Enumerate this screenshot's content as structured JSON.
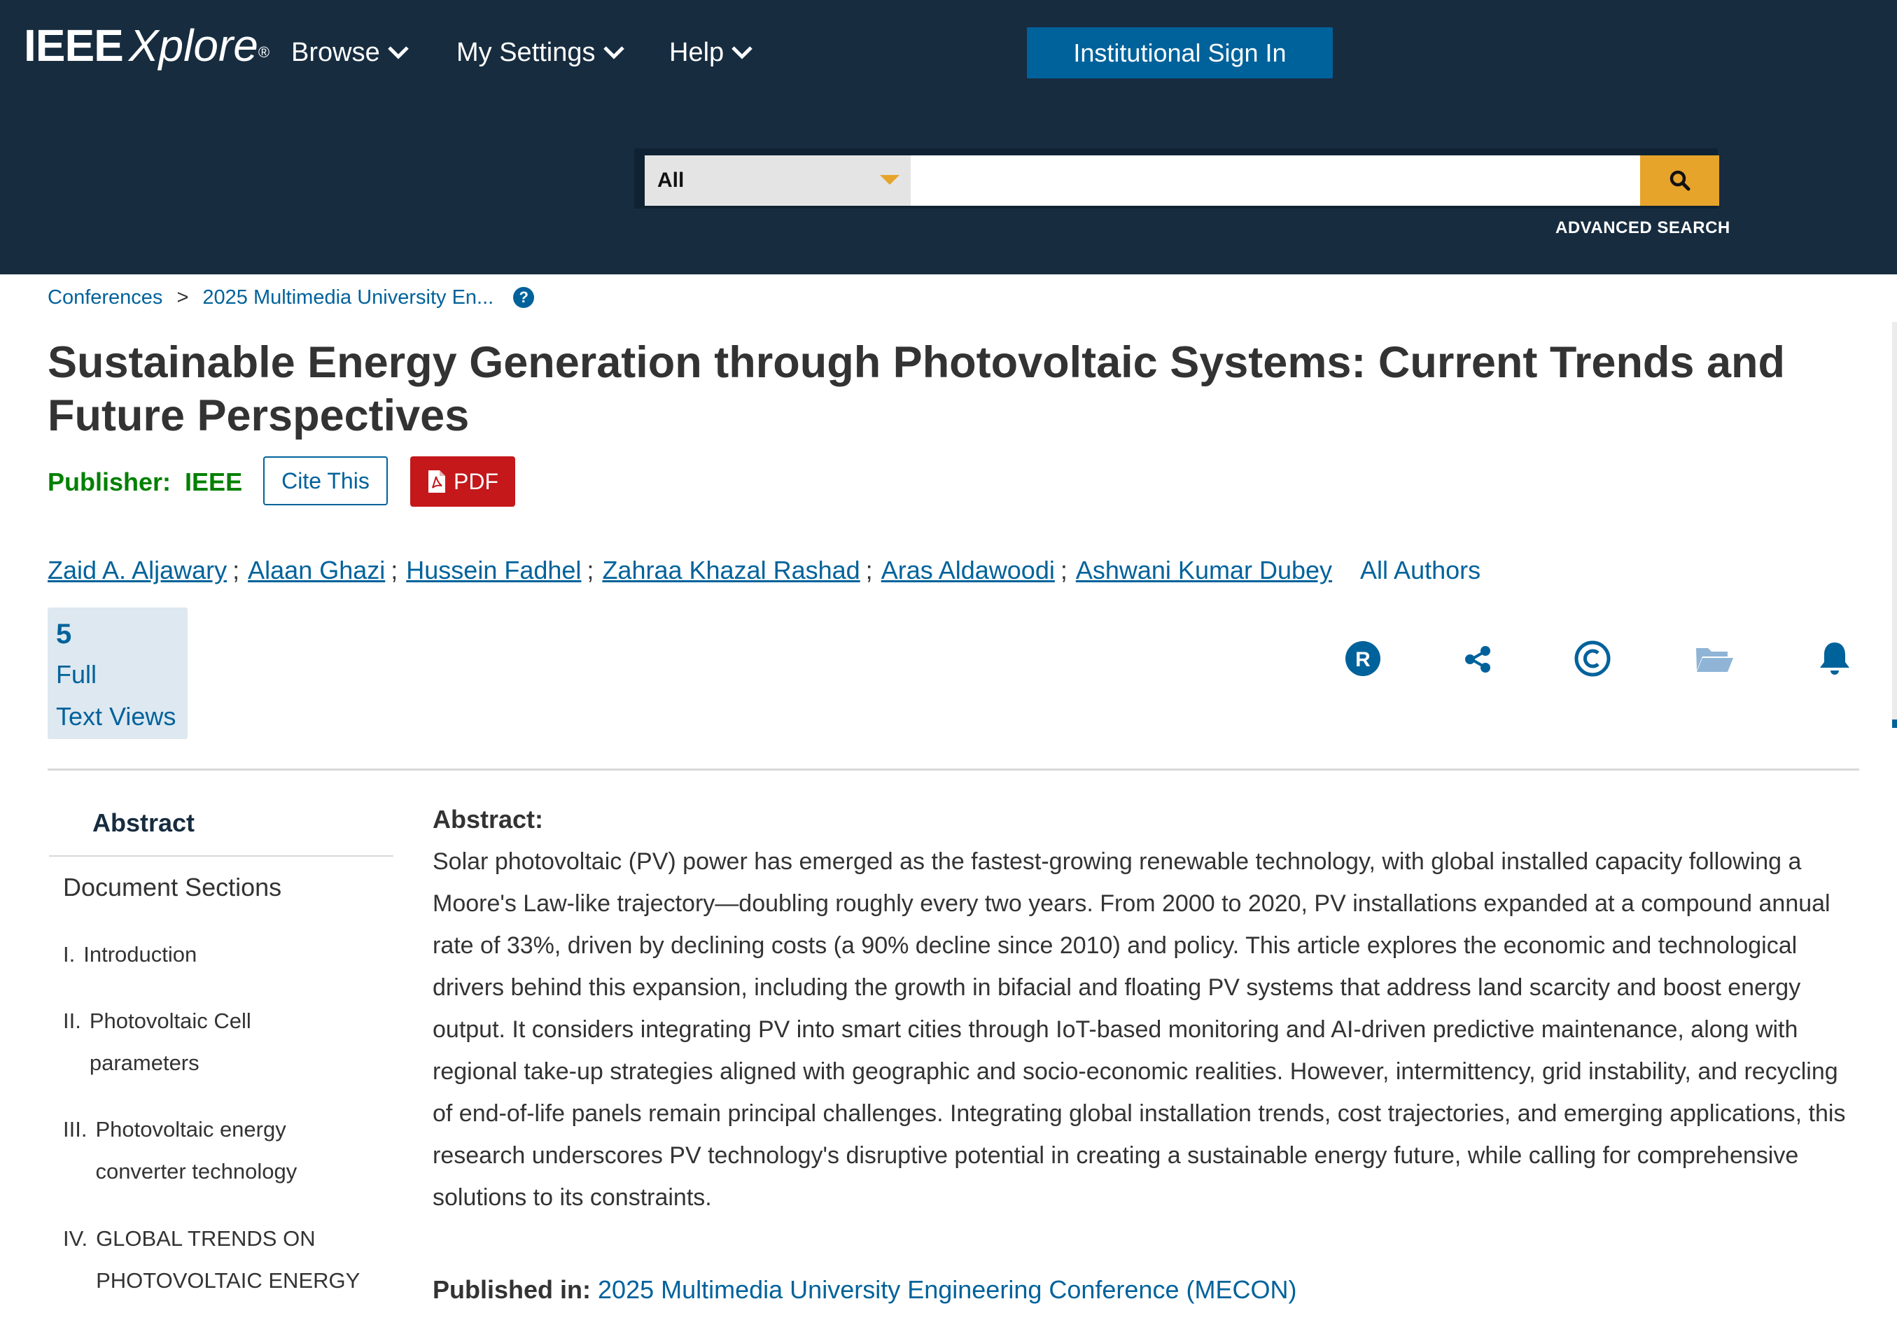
{
  "header": {
    "logo_main": "IEEE",
    "logo_sub": "Xplore",
    "logo_reg": "®",
    "nav": [
      {
        "label": "Browse"
      },
      {
        "label": "My Settings"
      },
      {
        "label": "Help"
      }
    ],
    "signin_label": "Institutional Sign In",
    "search": {
      "scope": "All",
      "query": "",
      "advanced_label": "ADVANCED SEARCH"
    }
  },
  "breadcrumb": {
    "items": [
      "Conferences",
      "2025 Multimedia University En..."
    ],
    "separator": ">",
    "help": "?"
  },
  "article": {
    "title": "Sustainable Energy Generation through Photovoltaic Systems: Current Trends and Future Perspectives",
    "publisher_label": "Publisher:",
    "publisher": "IEEE",
    "cite_label": "Cite This",
    "pdf_label": "PDF",
    "authors": [
      "Zaid A. Aljawary",
      "Alaan Ghazi",
      "Hussein Fadhel",
      "Zahraa Khazal Rashad",
      "Aras Aldawoodi",
      "Ashwani Kumar Dubey"
    ],
    "author_separator": ";",
    "all_authors_label": "All Authors"
  },
  "metrics": {
    "count": "5",
    "label": "Full\nText Views"
  },
  "actions": {
    "icons": [
      "rights-icon",
      "share-icon",
      "copyright-icon",
      "folder-icon",
      "bell-icon"
    ],
    "icon_color": "#00629b",
    "folder_color": "#8fb4d6"
  },
  "sidebar": {
    "active": "Abstract",
    "heading": "Document Sections",
    "sections": [
      {
        "num": "I.",
        "title": "Introduction"
      },
      {
        "num": "II.",
        "title": "Photovoltaic Cell\nparameters"
      },
      {
        "num": "III.",
        "title": "Photovoltaic energy\nconverter technology"
      },
      {
        "num": "IV.",
        "title": "GLOBAL TRENDS ON\nPHOTOVOLTAIC ENERGY"
      }
    ]
  },
  "abstract": {
    "heading": "Abstract:",
    "text": "Solar photovoltaic (PV) power has emerged as the fastest-growing renewable technology, with global installed capacity following a Moore's Law-like trajectory—doubling roughly every two years. From 2000 to 2020, PV installations expanded at a compound annual rate of 33%, driven by declining costs (a 90% decline since 2010) and policy. This article explores the economic and technological drivers behind this expansion, including the growth in bifacial and floating PV systems that address land scarcity and boost energy output. It considers integrating PV into smart cities through IoT-based monitoring and AI-driven predictive maintenance, along with regional take-up strategies aligned with geographic and socio-economic realities. However, intermittency, grid instability, and recycling of end-of-life panels remain principal challenges. Integrating global installation trends, cost trajectories, and emerging applications, this research underscores PV technology's disruptive potential in creating a sustainable energy future, while calling for comprehensive solutions to its constraints.",
    "published_label": "Published in:",
    "published_value": "2025 Multimedia University Engineering Conference (MECON)"
  },
  "colors": {
    "header_bg": "#172c3f",
    "link": "#00629b",
    "accent": "#e6a42b",
    "pdf": "#c4181b",
    "publisher": "#008000"
  }
}
